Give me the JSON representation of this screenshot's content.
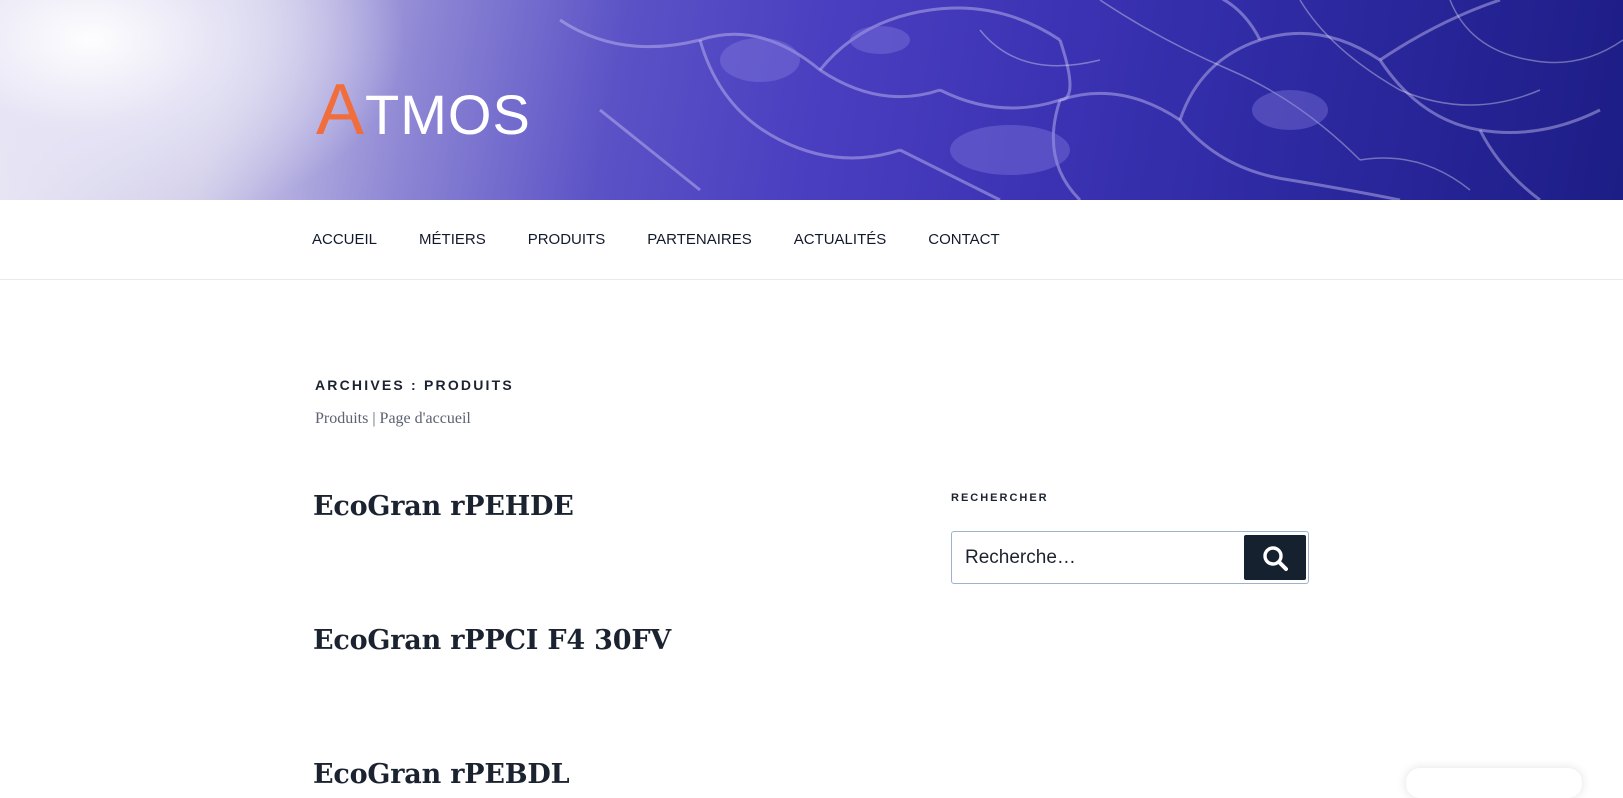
{
  "header": {
    "logo_first_letter": "A",
    "logo_rest": "TMOS",
    "colors": {
      "logo_accent": "#f26d3c",
      "logo_text": "#ffffff",
      "banner_dark": "#2e2aa3"
    }
  },
  "nav": {
    "items": [
      {
        "label": "ACCUEIL"
      },
      {
        "label": "MÉTIERS"
      },
      {
        "label": "PRODUITS"
      },
      {
        "label": "PARTENAIRES"
      },
      {
        "label": "ACTUALITÉS"
      },
      {
        "label": "CONTACT"
      }
    ]
  },
  "archive": {
    "title": "ARCHIVES : PRODUITS",
    "description": "Produits | Page d'accueil"
  },
  "posts": [
    {
      "title": "EcoGran rPEHDE"
    },
    {
      "title": "EcoGran rPPCI F4 30FV"
    },
    {
      "title": "EcoGran rPEBDL"
    }
  ],
  "sidebar": {
    "search_widget_title": "RECHERCHER",
    "search_placeholder": "Recherche…",
    "search_button_icon": "search-icon",
    "search_button_color": "#162130"
  }
}
